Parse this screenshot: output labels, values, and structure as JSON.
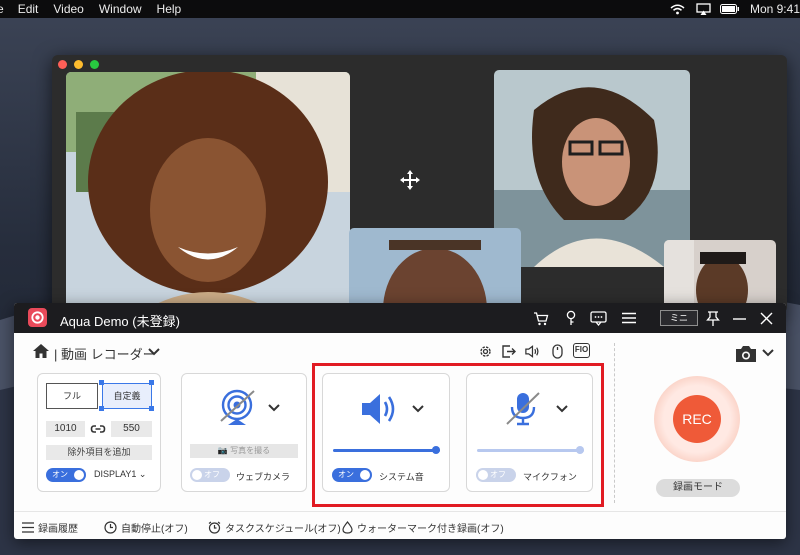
{
  "menubar": {
    "app_fragment": "e",
    "items": [
      "Edit",
      "Video",
      "Window",
      "Help"
    ],
    "clock": "Mon 9:41"
  },
  "recorder": {
    "title": "Aqua Demo (未登録)",
    "mini_label": "ミニ",
    "mode_label": "動画 レコーダー",
    "fio_label": "FIO",
    "region": {
      "full_label": "フル",
      "custom_label": "自定義",
      "width_value": "1010",
      "height_value": "550",
      "exclude_label": "除外項目を追加",
      "toggle_label": "オン",
      "display_value": "DISPLAY1"
    },
    "webcam": {
      "photo_label": "写真を撮る",
      "toggle_label": "オフ",
      "label": "ウェブカメラ"
    },
    "system_audio": {
      "toggle_label": "オン",
      "label": "システム音",
      "volume": 1.0
    },
    "microphone": {
      "toggle_label": "オフ",
      "label": "マイクフォン",
      "volume": 1.0
    },
    "rec_label": "REC",
    "rec_mode_label": "録画モード",
    "footer": {
      "history": "録画履歴",
      "auto_stop": "自動停止(オフ)",
      "schedule": "タスクスケジュール(オフ)",
      "watermark": "ウォーターマーク付き録画(オフ)"
    }
  },
  "colors": {
    "accent_blue": "#3a6fdd",
    "rec_orange": "#ef5a38",
    "highlight_red": "#e11b23",
    "titlebar": "#1c1c1f",
    "logo_red": "#e94a5a"
  },
  "icons": [
    "apple-menu-fragment",
    "wifi-icon",
    "airplay-icon",
    "battery-icon",
    "cart-icon",
    "key-icon",
    "chat-icon",
    "menu-icon",
    "minimize-icon",
    "pin-icon",
    "close-icon",
    "home-icon",
    "chevron-down-icon",
    "gear-icon",
    "export-icon",
    "speaker-icon",
    "mouse-icon",
    "camera-icon",
    "link-icon",
    "webcam-icon",
    "microphone-icon",
    "history-icon",
    "clock-icon",
    "alarm-icon",
    "watermark-icon",
    "move-icon"
  ]
}
